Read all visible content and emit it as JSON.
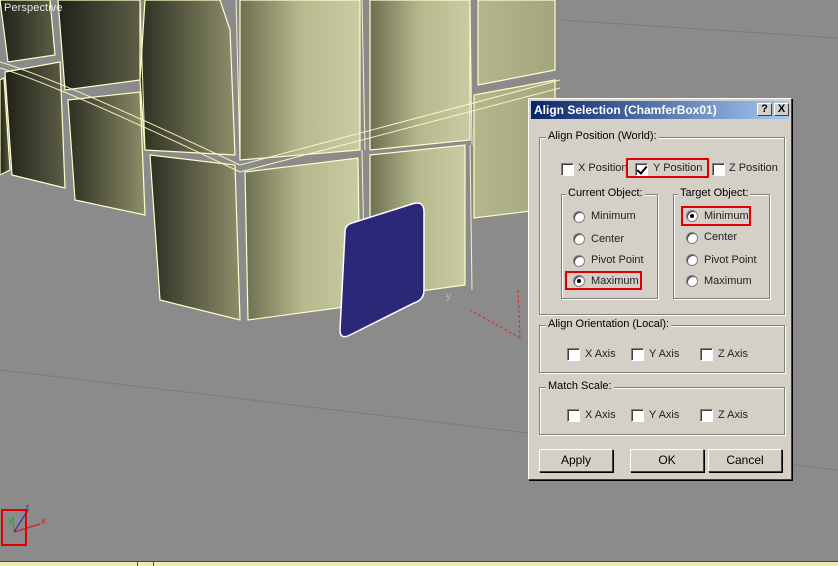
{
  "viewport": {
    "label": "Perspective",
    "colors": {
      "background": "#8b8b8b",
      "box_face": "#b9bb8f",
      "wire": "#ffffc8",
      "plane": "#2b2878"
    }
  },
  "dialog": {
    "title": "Align Selection (ChamferBox01)",
    "help_label": "?",
    "close_label": "X",
    "align_position": {
      "title": "Align Position (World):",
      "x_label": "X Position",
      "x_checked": false,
      "y_label": "Y Position",
      "y_checked": true,
      "z_label": "Z Position",
      "z_checked": false
    },
    "current_object": {
      "title": "Current Object:",
      "options": [
        "Minimum",
        "Center",
        "Pivot Point",
        "Maximum"
      ],
      "selected": "Maximum"
    },
    "target_object": {
      "title": "Target Object:",
      "options": [
        "Minimum",
        "Center",
        "Pivot Point",
        "Maximum"
      ],
      "selected": "Minimum"
    },
    "align_orientation": {
      "title": "Align Orientation (Local):",
      "x_label": "X Axis",
      "y_label": "Y Axis",
      "z_label": "Z Axis"
    },
    "match_scale": {
      "title": "Match Scale:",
      "x_label": "X Axis",
      "y_label": "Y Axis",
      "z_label": "Z Axis"
    },
    "buttons": {
      "apply": "Apply",
      "ok": "OK",
      "cancel": "Cancel"
    }
  },
  "axis_icon": {
    "x": "x",
    "y": "y",
    "z": "z"
  },
  "gizmo": {
    "y": "y"
  }
}
